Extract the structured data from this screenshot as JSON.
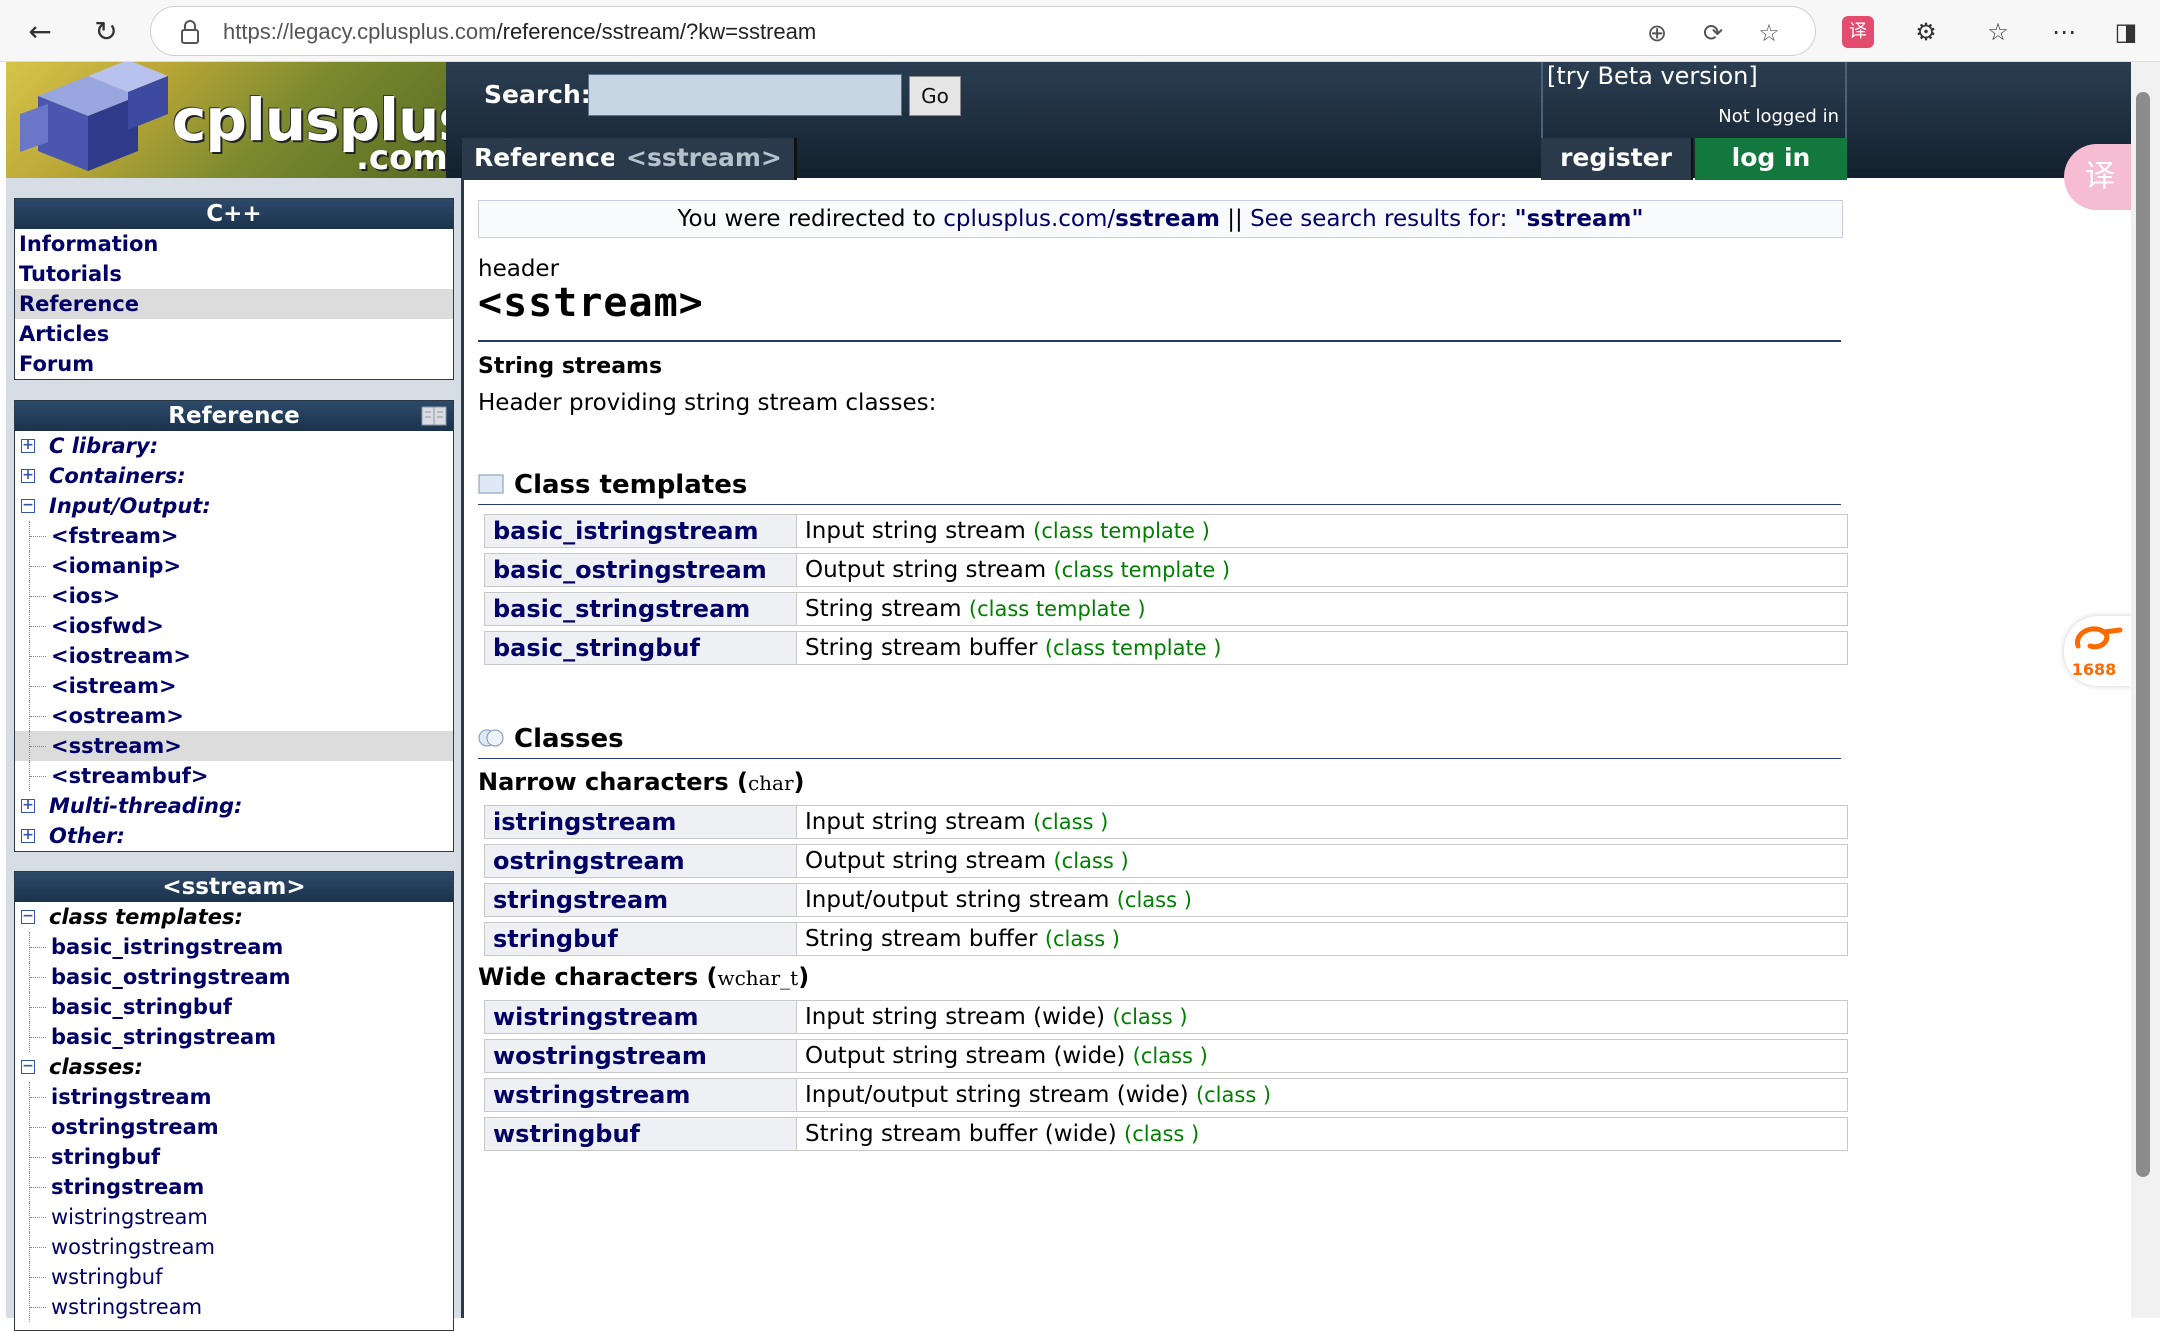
{
  "browser": {
    "url_host": "https://legacy.cplusplus.com",
    "url_path": "/reference/sstream/?kw=sstream",
    "back_icon": "back-arrow-icon",
    "refresh_icon": "refresh-icon"
  },
  "header": {
    "logo_text": "cplusplus",
    "logo_com": ".com",
    "search_label": "Search:",
    "search_placeholder": "",
    "go_label": "Go",
    "beta_label": "[try Beta version]",
    "not_logged_in": "Not logged in",
    "register": "register",
    "login": "log in",
    "breadcrumbs": [
      "Reference",
      "<sstream>"
    ]
  },
  "sidebar": {
    "cpp_box": {
      "title": "C++",
      "items": [
        "Information",
        "Tutorials",
        "Reference",
        "Articles",
        "Forum"
      ]
    },
    "reference_box": {
      "title": "Reference",
      "top_items": [
        "C library:",
        "Containers:",
        "Input/Output:"
      ],
      "io_children": [
        "<fstream>",
        "<iomanip>",
        "<ios>",
        "<iosfwd>",
        "<iostream>",
        "<istream>",
        "<ostream>",
        "<sstream>",
        "<streambuf>"
      ],
      "bottom_items": [
        "Multi-threading:",
        "Other:"
      ]
    },
    "sstream_box": {
      "title": "<sstream>",
      "class_templates_label": "class templates:",
      "class_templates": [
        "basic_istringstream",
        "basic_ostringstream",
        "basic_stringbuf",
        "basic_stringstream"
      ],
      "classes_label": "classes:",
      "classes_bold": [
        "istringstream",
        "ostringstream",
        "stringbuf",
        "stringstream"
      ],
      "classes_light": [
        "wistringstream",
        "wostringstream",
        "wstringbuf",
        "wstringstream"
      ]
    }
  },
  "main": {
    "redirect_prefix": "You were redirected to ",
    "redirect_link": "cplusplus.com/",
    "redirect_bold": "sstream",
    "redirect_sep": " || ",
    "redirect_search": "See search results for: ",
    "redirect_query": "\"sstream\"",
    "kind": "header",
    "title": "<sstream>",
    "subtitle": "String streams",
    "description": "Header providing string stream classes:",
    "class_templates_heading": "Class templates",
    "class_templates": [
      {
        "name": "basic_istringstream",
        "desc": "Input string stream",
        "tag": "(class template )"
      },
      {
        "name": "basic_ostringstream",
        "desc": "Output string stream",
        "tag": "(class template )"
      },
      {
        "name": "basic_stringstream",
        "desc": "String stream",
        "tag": "(class template )"
      },
      {
        "name": "basic_stringbuf",
        "desc": "String stream buffer",
        "tag": "(class template )"
      }
    ],
    "classes_heading": "Classes",
    "narrow_label": "Narrow characters (",
    "narrow_type": "char",
    "wide_label": "Wide characters (",
    "wide_type": "wchar_t",
    "close_paren": ")",
    "narrow_classes": [
      {
        "name": "istringstream",
        "desc": "Input string stream",
        "tag": "(class )"
      },
      {
        "name": "ostringstream",
        "desc": "Output string stream",
        "tag": "(class )"
      },
      {
        "name": "stringstream",
        "desc": "Input/output string stream",
        "tag": "(class )"
      },
      {
        "name": "stringbuf",
        "desc": "String stream buffer",
        "tag": "(class )"
      }
    ],
    "wide_classes": [
      {
        "name": "wistringstream",
        "desc": "Input string stream (wide)",
        "tag": "(class )"
      },
      {
        "name": "wostringstream",
        "desc": "Output string stream (wide)",
        "tag": "(class )"
      },
      {
        "name": "wstringstream",
        "desc": "Input/output string stream (wide)",
        "tag": "(class )"
      },
      {
        "name": "wstringbuf",
        "desc": "String stream buffer (wide)",
        "tag": "(class )"
      }
    ]
  },
  "extras": {
    "fab_1688": "1688",
    "translate_icon": "translate-icon"
  }
}
